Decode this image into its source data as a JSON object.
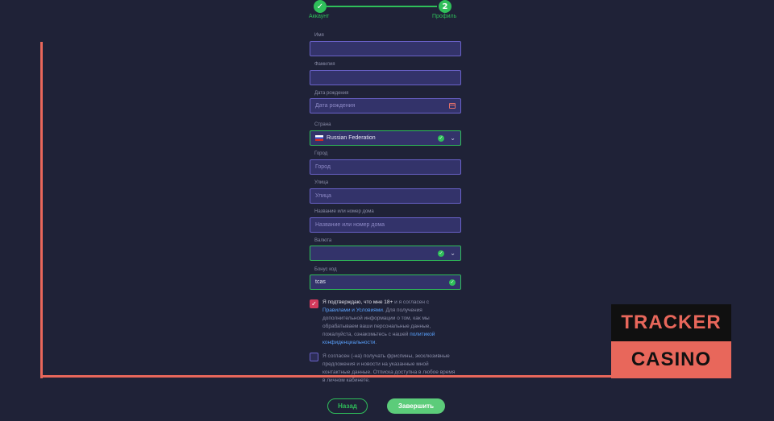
{
  "stepper": {
    "step1_symbol": "✓",
    "step1_label": "Аккаунт",
    "step2_number": "2",
    "step2_label": "Профиль"
  },
  "form": {
    "first_name": {
      "label": "Имя",
      "value": ""
    },
    "last_name": {
      "label": "Фамилия",
      "value": ""
    },
    "birth_date": {
      "label": "Дата рождения",
      "placeholder": "Дата рождения"
    },
    "country": {
      "label": "Страна",
      "value": "Russian Federation"
    },
    "city": {
      "label": "Город",
      "placeholder": "Город"
    },
    "street": {
      "label": "Улица",
      "placeholder": "Улица"
    },
    "house": {
      "label": "Название или номер дома",
      "placeholder": "Название или номер дома"
    },
    "currency": {
      "label": "Валюта",
      "value": ""
    },
    "bonus_code": {
      "label": "Бонус код",
      "value": "tcas"
    }
  },
  "consent": {
    "age_checked": true,
    "age_prefix": "Я подтверждаю, что мне 18+",
    "age_mid": " и я согласен с ",
    "rules_link": "Правилами и Условиями",
    "age_rest": ". Для получения дополнительной информации о том, как мы обрабатываем ваши персональные данные, пожалуйста, ознакомьтесь с нашей ",
    "privacy_link": "политикой конфиденциальности",
    "age_end": ".",
    "marketing_checked": false,
    "marketing_text": "Я согласен (-на) получать фриспины, эксклюзивные предложения и новости на указанные мной контактные данные. Отписка доступна в любое время в личном кабинете."
  },
  "buttons": {
    "back": "Назад",
    "finish": "Завершить"
  },
  "watermark": {
    "line1": "TRACKER",
    "line2": "CASINO"
  },
  "colors": {
    "accent_green": "#2fbf5a",
    "field_border": "#6a62c9",
    "background": "#1f2237",
    "watermark_red": "#e8675b"
  }
}
